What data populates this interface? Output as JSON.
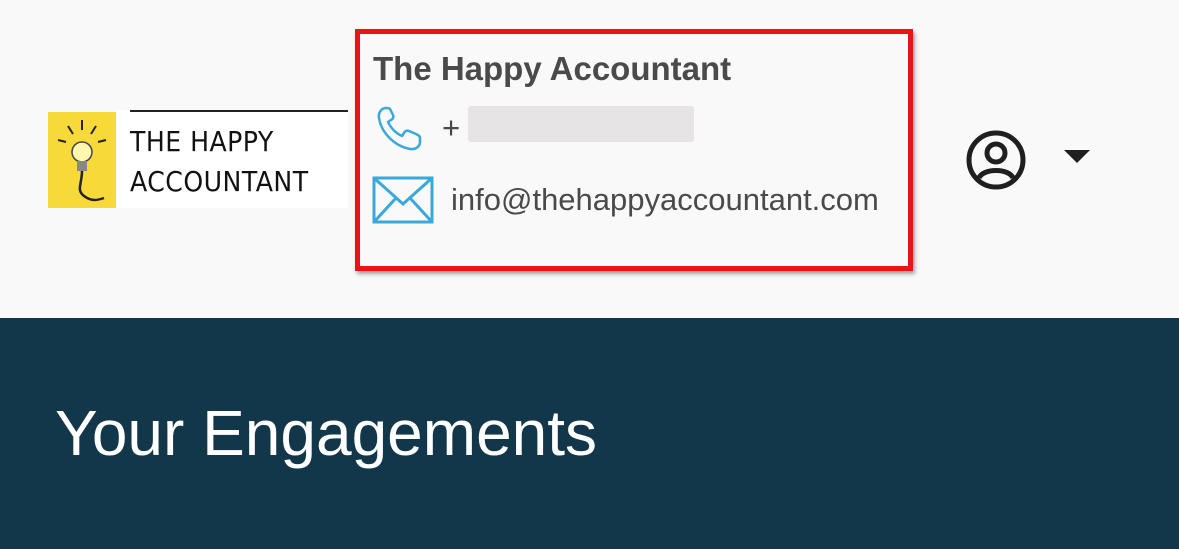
{
  "header": {
    "logo": {
      "line1": "THE HAPPY",
      "line2": "ACCOUNTANT",
      "icon": "lightbulb-icon",
      "brand_color": "#f7d93a"
    },
    "contact": {
      "name": "The Happy Accountant",
      "phone_prefix": "+",
      "phone_icon": "phone-icon",
      "email": "info@thehappyaccountant.com",
      "email_icon": "envelope-icon",
      "icon_color": "#3aa8d8",
      "highlight_color": "#e8141a"
    },
    "user_menu": {
      "icon": "user-circle-icon",
      "caret_icon": "caret-down-icon"
    }
  },
  "banner": {
    "title": "Your Engagements",
    "background": "#13374a"
  }
}
